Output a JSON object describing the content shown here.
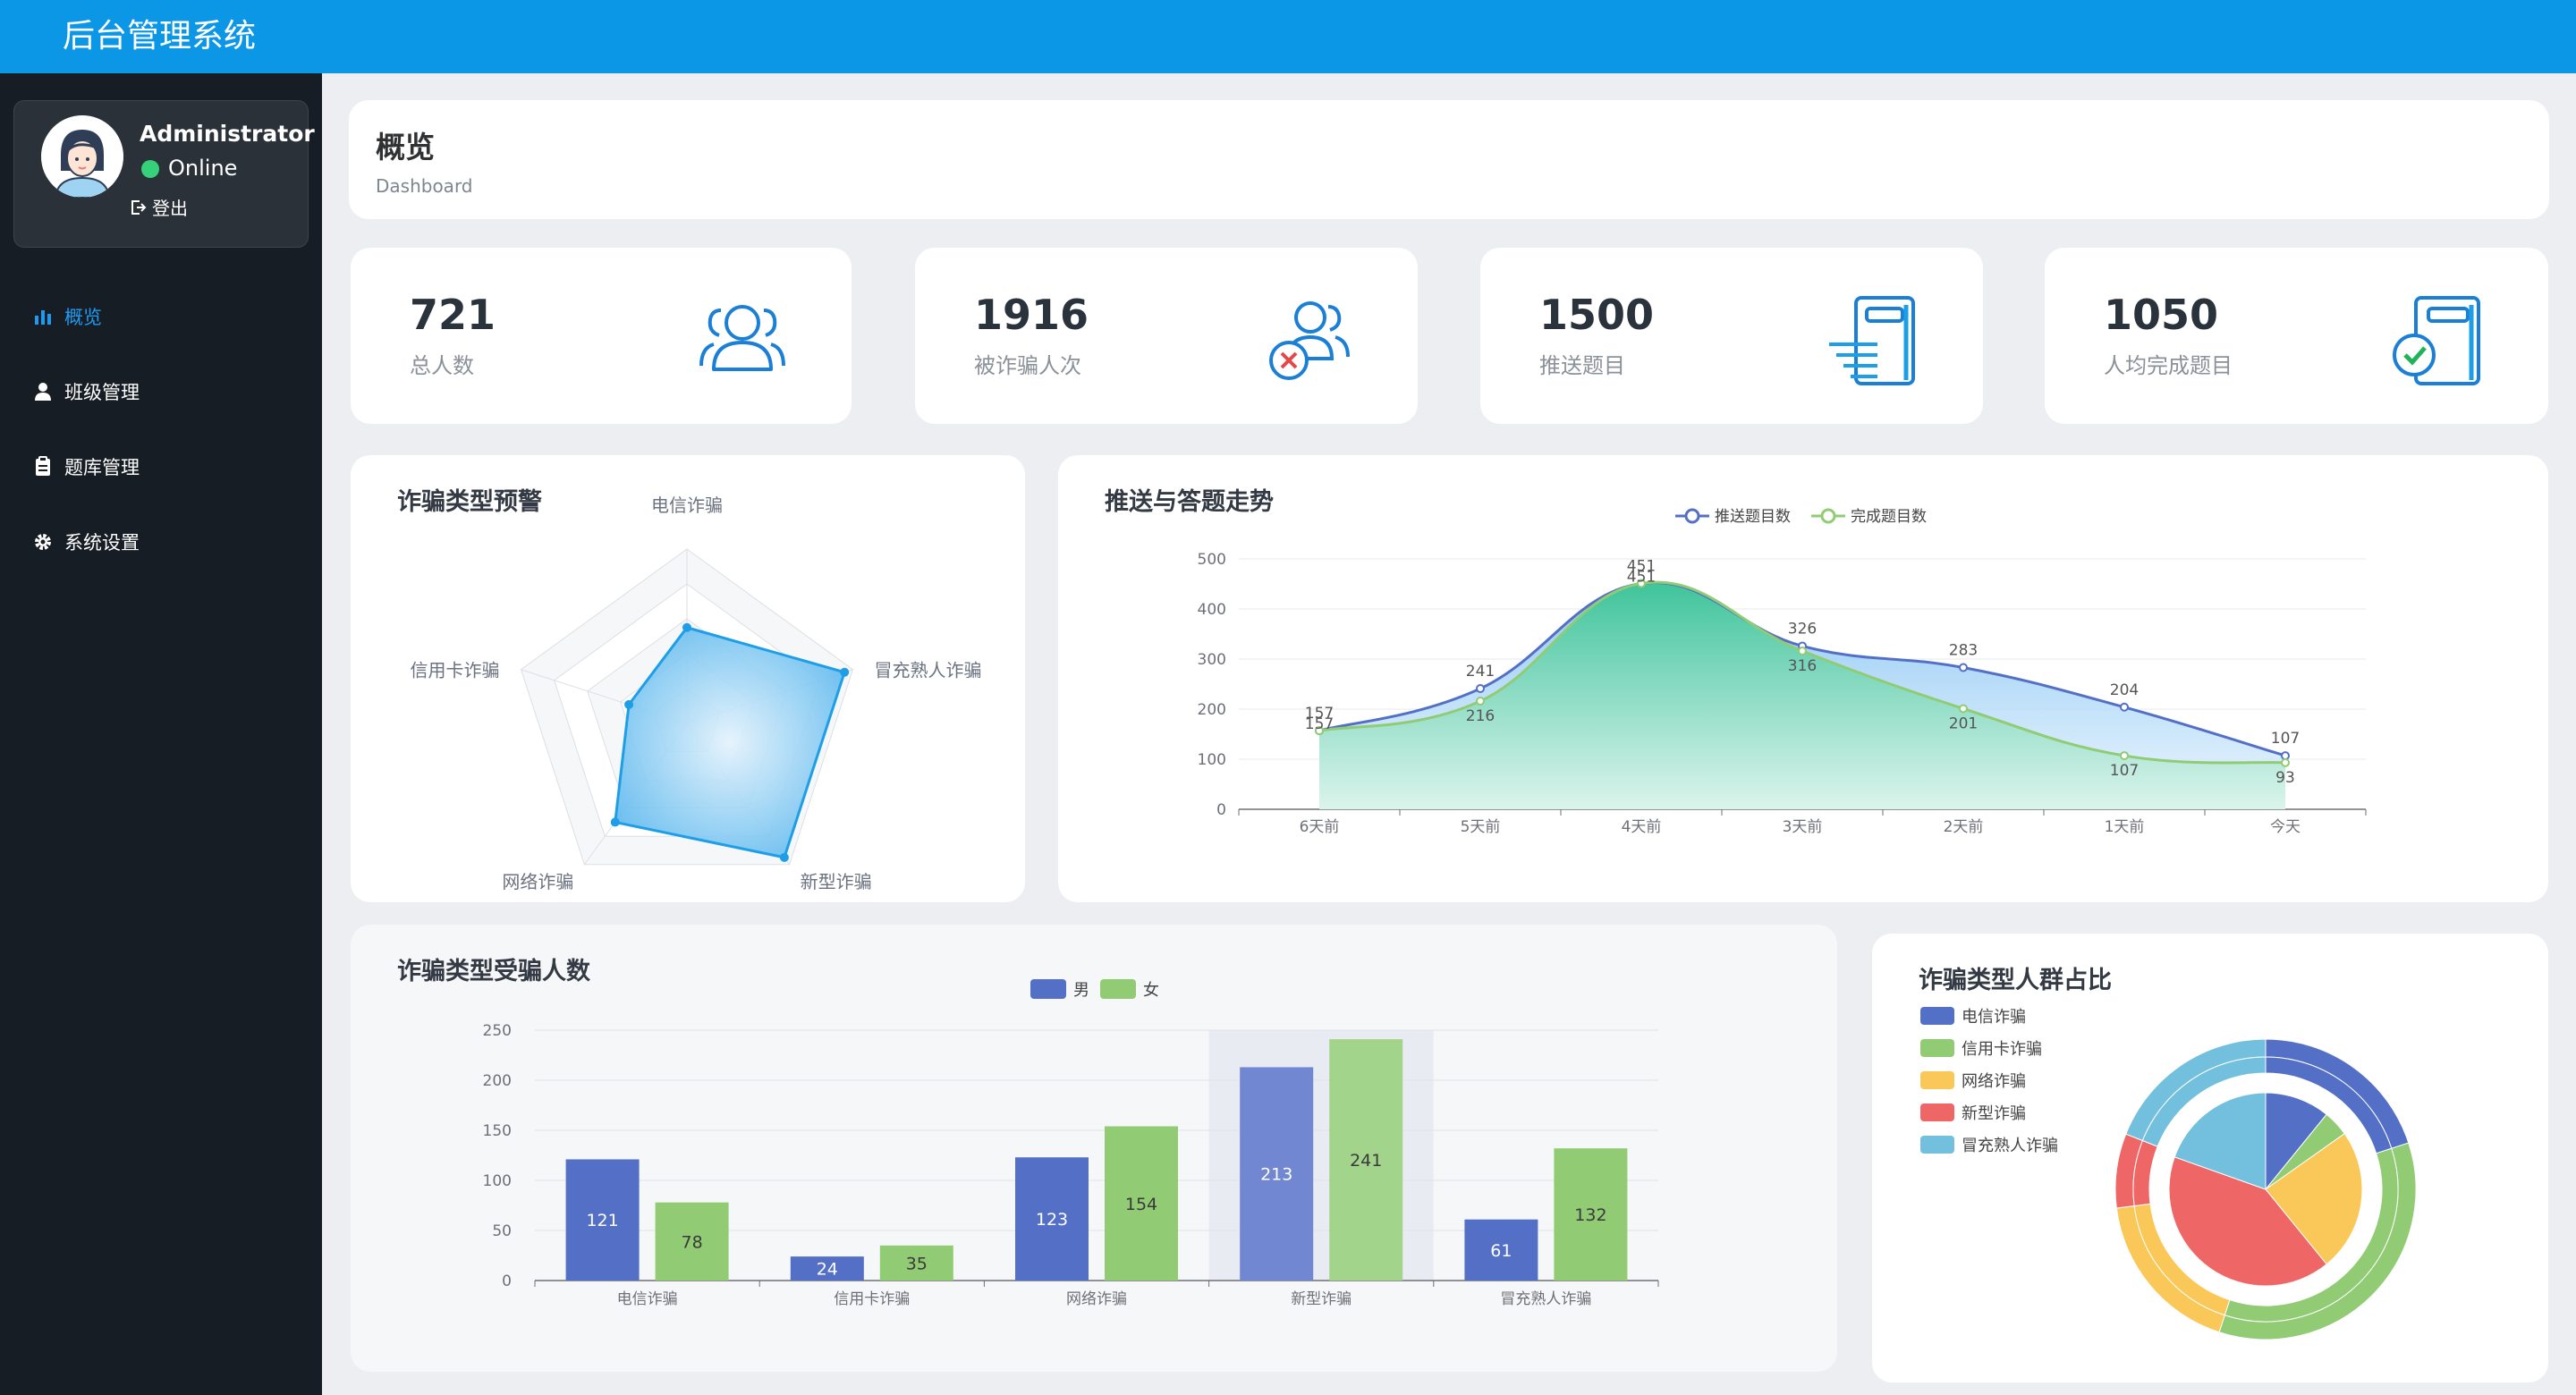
{
  "app": {
    "title": "后台管理系统"
  },
  "user": {
    "name": "Administrator",
    "status": "Online",
    "logout_label": "登出"
  },
  "nav": [
    {
      "label": "概览",
      "icon": "bar-chart-icon",
      "active": true
    },
    {
      "label": "班级管理",
      "icon": "user-icon",
      "active": false
    },
    {
      "label": "题库管理",
      "icon": "clipboard-icon",
      "active": false
    },
    {
      "label": "系统设置",
      "icon": "gear-icon",
      "active": false
    }
  ],
  "page": {
    "title": "概览",
    "subtitle": "Dashboard"
  },
  "stats": [
    {
      "value": "721",
      "label": "总人数",
      "icon": "users-icon"
    },
    {
      "value": "1916",
      "label": "被诈骗人次",
      "icon": "users-x-icon"
    },
    {
      "value": "1500",
      "label": "推送题目",
      "icon": "document-push-icon"
    },
    {
      "value": "1050",
      "label": "人均完成题目",
      "icon": "document-check-icon"
    }
  ],
  "colors": {
    "header": "#0c96e6",
    "sidebar": "#171d24",
    "blue": "#5470c6",
    "green": "#91cc75",
    "yellow": "#fac858",
    "red": "#ee6666",
    "cyan": "#73c0de",
    "radar": "#1e9ee6"
  },
  "chart_data": [
    {
      "type": "radar",
      "title": "诈骗类型预警",
      "indicators": [
        "电信诈骗",
        "冒充熟人诈骗",
        "新型诈骗",
        "网络诈骗",
        "信用卡诈骗"
      ],
      "values": [
        0.55,
        0.95,
        0.95,
        0.7,
        0.35
      ]
    },
    {
      "type": "line",
      "title": "推送与答题走势",
      "categories": [
        "6天前",
        "5天前",
        "4天前",
        "3天前",
        "2天前",
        "1天前",
        "今天"
      ],
      "ylim": [
        0,
        500
      ],
      "yticks": [
        0,
        100,
        200,
        300,
        400,
        500
      ],
      "series": [
        {
          "name": "推送题目数",
          "values": [
            157,
            241,
            451,
            326,
            283,
            204,
            107
          ]
        },
        {
          "name": "完成题目数",
          "values": [
            157,
            216,
            451,
            316,
            201,
            107,
            93
          ]
        }
      ]
    },
    {
      "type": "bar",
      "title": "诈骗类型受骗人数",
      "categories": [
        "电信诈骗",
        "信用卡诈骗",
        "网络诈骗",
        "新型诈骗",
        "冒充熟人诈骗"
      ],
      "ylim": [
        0,
        250
      ],
      "yticks": [
        0,
        50,
        100,
        150,
        200,
        250
      ],
      "series": [
        {
          "name": "男",
          "values": [
            121,
            24,
            123,
            213,
            61
          ]
        },
        {
          "name": "女",
          "values": [
            78,
            35,
            154,
            241,
            132
          ]
        }
      ]
    },
    {
      "type": "pie",
      "title": "诈骗类型人群占比",
      "legend": [
        "电信诈骗",
        "信用卡诈骗",
        "网络诈骗",
        "新型诈骗",
        "冒充熟人诈骗"
      ],
      "inner": [
        10,
        4,
        22,
        38,
        18
      ],
      "outer": [
        20,
        35,
        18,
        8,
        19
      ]
    }
  ]
}
